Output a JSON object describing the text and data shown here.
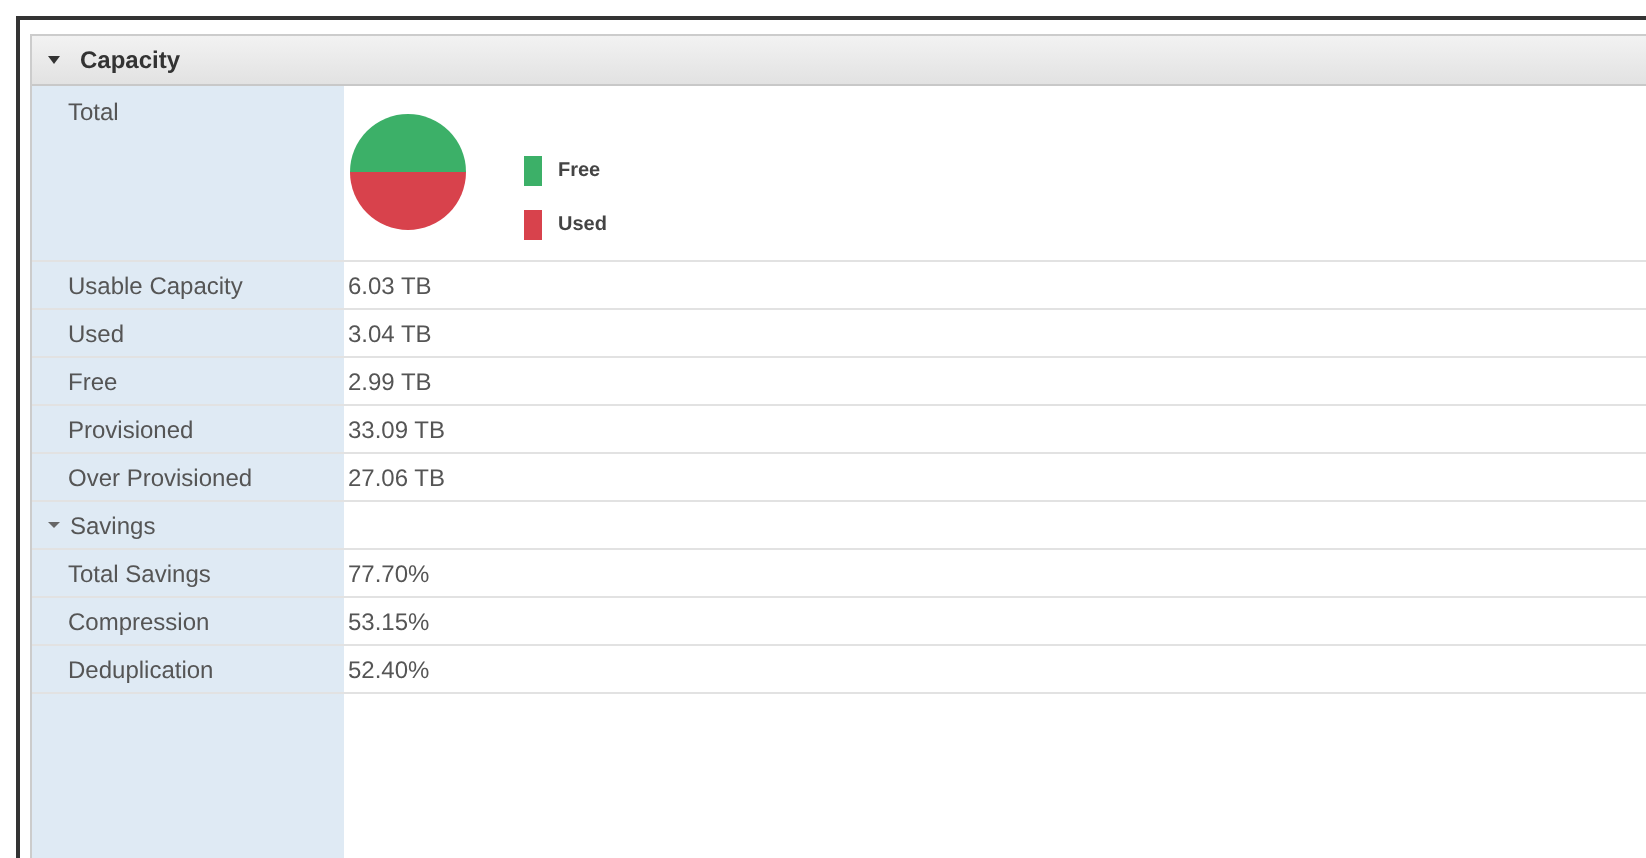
{
  "panel": {
    "title": "Capacity",
    "expanded": true
  },
  "total": {
    "label": "Total",
    "legend": [
      {
        "label": "Free",
        "color": "#3cb068"
      },
      {
        "label": "Used",
        "color": "#d8424c"
      }
    ]
  },
  "rows": [
    {
      "kind": "field",
      "label": "Usable Capacity",
      "value": "6.03 TB"
    },
    {
      "kind": "field",
      "label": "Used",
      "value": "3.04 TB"
    },
    {
      "kind": "field",
      "label": "Free",
      "value": "2.99 TB"
    },
    {
      "kind": "field",
      "label": "Provisioned",
      "value": "33.09 TB"
    },
    {
      "kind": "field",
      "label": "Over Provisioned",
      "value": "27.06 TB"
    },
    {
      "kind": "group",
      "label": "Savings",
      "expanded": true
    },
    {
      "kind": "field",
      "label": "Total Savings",
      "value": "77.70%"
    },
    {
      "kind": "field",
      "label": "Compression",
      "value": "53.15%"
    },
    {
      "kind": "field",
      "label": "Deduplication",
      "value": "52.40%"
    }
  ]
}
